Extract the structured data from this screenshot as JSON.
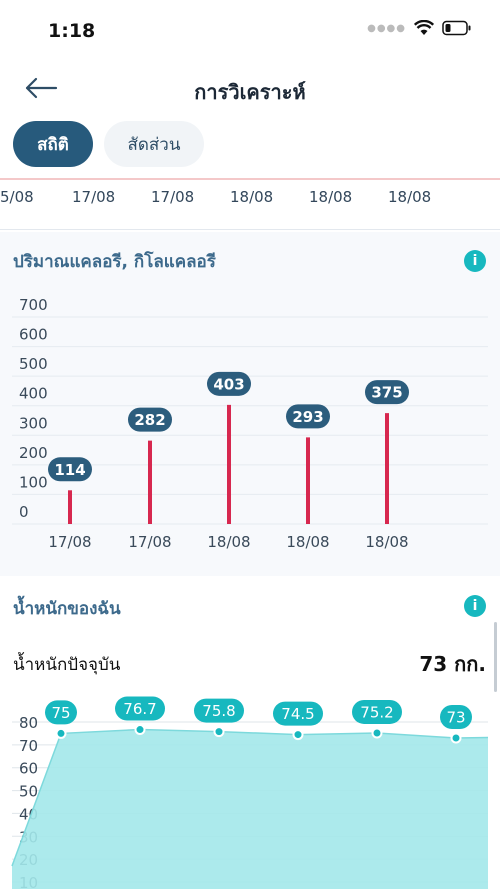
{
  "status_bar": {
    "time": "1:18"
  },
  "header": {
    "title": "การวิเคราะห์"
  },
  "tabs": [
    {
      "label": "สถิติ",
      "active": true
    },
    {
      "label": "สัดส่วน",
      "active": false
    }
  ],
  "date_strip": [
    "5/08",
    "17/08",
    "17/08",
    "18/08",
    "18/08",
    "18/08"
  ],
  "calorie_card": {
    "title": "ปริมาณแคลอรี, กิโลแคลอรี",
    "info_icon": "info-icon"
  },
  "weight_card": {
    "title": "น้ำหนักของฉัน",
    "info_icon": "info-icon",
    "current_label": "น้ำหนักปัจจุบัน",
    "current_value": "73 กก."
  },
  "colors": {
    "accent": "#275a7c",
    "bar": "#d7284f",
    "weight_fill": "#a3e8ea",
    "weight_line": "#17b8bf",
    "calorie_label_bg": "#2c5d7d"
  },
  "chart_data": [
    {
      "type": "bar",
      "title": "ปริมาณแคลอรี, กิโลแคลอรี",
      "categories": [
        "17/08",
        "17/08",
        "18/08",
        "18/08",
        "18/08"
      ],
      "values": [
        114,
        282,
        403,
        293,
        375
      ],
      "data_labels": [
        "114",
        "282",
        "403",
        "293",
        "375"
      ],
      "y_ticks": [
        "700",
        "600",
        "500",
        "400",
        "300",
        "200",
        "100",
        "0"
      ],
      "ylim": [
        0,
        700
      ],
      "grid": true
    },
    {
      "type": "area",
      "title": "น้ำหนักของฉัน",
      "values": [
        75,
        76.7,
        75.8,
        74.5,
        75.2,
        73
      ],
      "data_labels": [
        "75",
        "76.7",
        "75.8",
        "74.5",
        "75.2",
        "73"
      ],
      "y_ticks": [
        "80",
        "70",
        "60",
        "50",
        "40",
        "30",
        "20",
        "10"
      ],
      "ylim": [
        0,
        80
      ],
      "grid": true
    }
  ]
}
